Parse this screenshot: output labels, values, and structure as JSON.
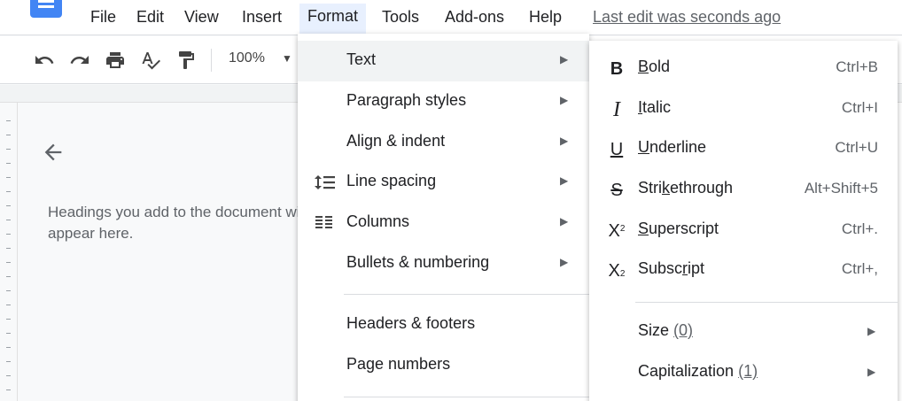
{
  "menubar": {
    "items": [
      "File",
      "Edit",
      "View",
      "Insert",
      "Format",
      "Tools",
      "Add-ons",
      "Help"
    ],
    "active": "Format",
    "last_edit": "Last edit was seconds ago"
  },
  "toolbar": {
    "zoom": "100%",
    "icons": [
      "undo-icon",
      "redo-icon",
      "print-icon",
      "spellcheck-icon",
      "paint-format-icon"
    ]
  },
  "outline": {
    "text": "Headings you add to the document will appear here."
  },
  "format_menu": {
    "items": [
      {
        "label": "Text",
        "submenu": true
      },
      {
        "label": "Paragraph styles",
        "submenu": true
      },
      {
        "label": "Align & indent",
        "submenu": true
      },
      {
        "label": "Line spacing",
        "submenu": true
      },
      {
        "label": "Columns",
        "submenu": true
      },
      {
        "label": "Bullets & numbering",
        "submenu": true
      },
      {
        "label": "Headers & footers"
      },
      {
        "label": "Page numbers"
      }
    ]
  },
  "text_submenu": {
    "items": [
      {
        "pre": "",
        "u": "B",
        "post": "old",
        "shortcut": "Ctrl+B",
        "icon": "bold-icon"
      },
      {
        "pre": "",
        "u": "I",
        "post": "talic",
        "shortcut": "Ctrl+I",
        "icon": "italic-icon"
      },
      {
        "pre": "",
        "u": "U",
        "post": "nderline",
        "shortcut": "Ctrl+U",
        "icon": "underline-icon"
      },
      {
        "pre": "Stri",
        "u": "k",
        "post": "ethrough",
        "shortcut": "Alt+Shift+5",
        "icon": "strikethrough-icon"
      },
      {
        "pre": "",
        "u": "S",
        "post": "uperscript",
        "shortcut": "Ctrl+.",
        "icon": "superscript-icon"
      },
      {
        "pre": "Subsc",
        "u": "r",
        "post": "ipt",
        "shortcut": "Ctrl+,",
        "icon": "subscript-icon"
      }
    ],
    "size": {
      "label": "Size",
      "count": "(0)"
    },
    "capitalization": {
      "label": "Capitalization",
      "count": "(1)"
    }
  }
}
